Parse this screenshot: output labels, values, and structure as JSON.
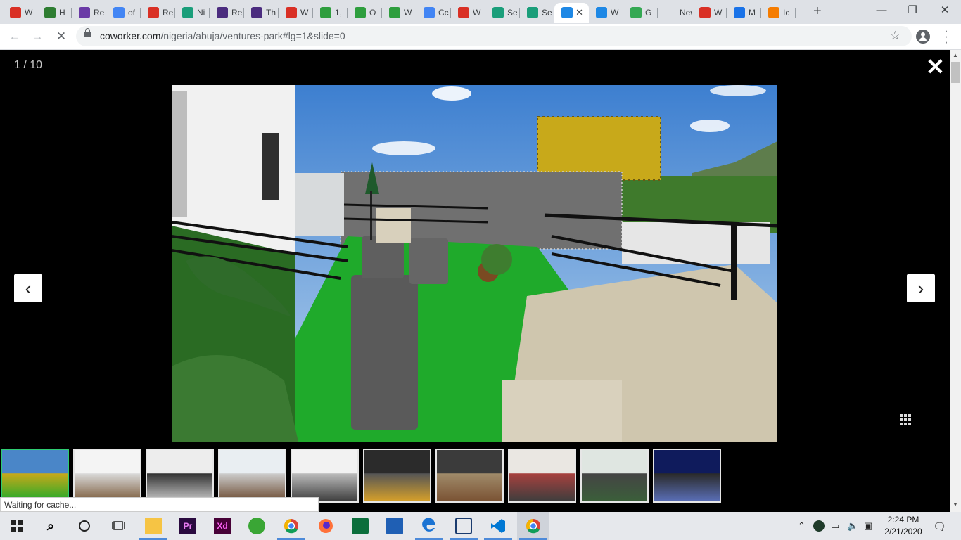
{
  "browser": {
    "tabs": [
      {
        "label": "W",
        "favicon": "red-cross",
        "color": "#d93025"
      },
      {
        "label": "H",
        "favicon": "jiji",
        "color": "#2e7d32"
      },
      {
        "label": "Re",
        "favicon": "purple-circle",
        "color": "#6a3aa6"
      },
      {
        "label": "of",
        "favicon": "google",
        "color": "#4285f4"
      },
      {
        "label": "Re",
        "favicon": "house",
        "color": "#d93025"
      },
      {
        "label": "Ni",
        "favicon": "camera",
        "color": "#1a9e7a"
      },
      {
        "label": "Re",
        "favicon": "colorlib",
        "color": "#4b2c7f"
      },
      {
        "label": "Th",
        "favicon": "colorlib",
        "color": "#4b2c7f"
      },
      {
        "label": "W",
        "favicon": "red-cross",
        "color": "#d93025"
      },
      {
        "label": "1,",
        "favicon": "px",
        "color": "#2e9e3e"
      },
      {
        "label": "O",
        "favicon": "px",
        "color": "#2e9e3e"
      },
      {
        "label": "W",
        "favicon": "px",
        "color": "#2e9e3e"
      },
      {
        "label": "Cc",
        "favicon": "google",
        "color": "#4285f4"
      },
      {
        "label": "W",
        "favicon": "red-cross",
        "color": "#d93025"
      },
      {
        "label": "Se",
        "favicon": "camera",
        "color": "#1a9e7a"
      },
      {
        "label": "Se",
        "favicon": "camera",
        "color": "#1a9e7a"
      },
      {
        "label": "",
        "favicon": "coworker",
        "color": "#1e88e5",
        "active": true
      },
      {
        "label": "W",
        "favicon": "coworker",
        "color": "#1e88e5"
      },
      {
        "label": "G",
        "favicon": "leaf",
        "color": "#34a853"
      },
      {
        "label": "New T",
        "favicon": "",
        "color": ""
      },
      {
        "label": "W",
        "favicon": "red-cross",
        "color": "#d93025"
      },
      {
        "label": "M",
        "favicon": "flag",
        "color": "#1a73e8"
      },
      {
        "label": "Ic",
        "favicon": "orange-box",
        "color": "#f57c00"
      }
    ],
    "new_tab_glyph": "+",
    "window_controls": {
      "minimize": "—",
      "restore": "❐",
      "close": "✕"
    },
    "url_host": "coworker.com",
    "url_path": "/nigeria/abuja/ventures-park#lg=1&slide=0"
  },
  "viewer": {
    "counter": "1 / 10",
    "close_glyph": "✕",
    "prev_glyph": "‹",
    "next_glyph": "›",
    "thumbnails": [
      "rooftop-terrace",
      "office-desks",
      "hallway",
      "meeting-room",
      "training-room",
      "staircase-lounge",
      "dining-area",
      "coworking-people",
      "lounge-people",
      "night-exterior"
    ],
    "active_thumbnail": 0
  },
  "status_bar": {
    "text": "Waiting for cache..."
  },
  "taskbar": {
    "apps": [
      "file-explorer",
      "premiere-pro",
      "adobe-xd",
      "greenshot",
      "chrome",
      "firefox",
      "media-player",
      "news",
      "edge",
      "app-tile",
      "vscode",
      "chrome-active"
    ],
    "time": "2:24 PM",
    "date": "2/21/2020"
  }
}
